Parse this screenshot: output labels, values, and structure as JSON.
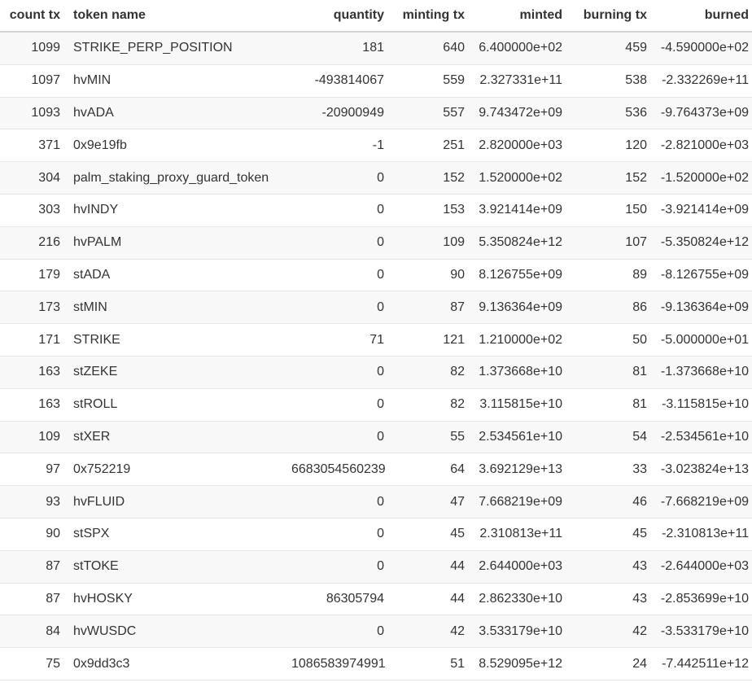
{
  "table": {
    "headers": [
      "count tx",
      "token name",
      "quantity",
      "minting tx",
      "minted",
      "burning tx",
      "burned"
    ],
    "rows": [
      [
        "1099",
        "STRIKE_PERP_POSITION",
        "181",
        "640",
        "6.400000e+02",
        "459",
        "-4.590000e+02"
      ],
      [
        "1097",
        "hvMIN",
        "-493814067",
        "559",
        "2.327331e+11",
        "538",
        "-2.332269e+11"
      ],
      [
        "1093",
        "hvADA",
        "-20900949",
        "557",
        "9.743472e+09",
        "536",
        "-9.764373e+09"
      ],
      [
        "371",
        "0x9e19fb",
        "-1",
        "251",
        "2.820000e+03",
        "120",
        "-2.821000e+03"
      ],
      [
        "304",
        "palm_staking_proxy_guard_token",
        "0",
        "152",
        "1.520000e+02",
        "152",
        "-1.520000e+02"
      ],
      [
        "303",
        "hvINDY",
        "0",
        "153",
        "3.921414e+09",
        "150",
        "-3.921414e+09"
      ],
      [
        "216",
        "hvPALM",
        "0",
        "109",
        "5.350824e+12",
        "107",
        "-5.350824e+12"
      ],
      [
        "179",
        "stADA",
        "0",
        "90",
        "8.126755e+09",
        "89",
        "-8.126755e+09"
      ],
      [
        "173",
        "stMIN",
        "0",
        "87",
        "9.136364e+09",
        "86",
        "-9.136364e+09"
      ],
      [
        "171",
        "STRIKE",
        "71",
        "121",
        "1.210000e+02",
        "50",
        "-5.000000e+01"
      ],
      [
        "163",
        "stZEKE",
        "0",
        "82",
        "1.373668e+10",
        "81",
        "-1.373668e+10"
      ],
      [
        "163",
        "stROLL",
        "0",
        "82",
        "3.115815e+10",
        "81",
        "-3.115815e+10"
      ],
      [
        "109",
        "stXER",
        "0",
        "55",
        "2.534561e+10",
        "54",
        "-2.534561e+10"
      ],
      [
        "97",
        "0x752219",
        "6683054560239",
        "64",
        "3.692129e+13",
        "33",
        "-3.023824e+13"
      ],
      [
        "93",
        "hvFLUID",
        "0",
        "47",
        "7.668219e+09",
        "46",
        "-7.668219e+09"
      ],
      [
        "90",
        "stSPX",
        "0",
        "45",
        "2.310813e+11",
        "45",
        "-2.310813e+11"
      ],
      [
        "87",
        "stTOKE",
        "0",
        "44",
        "2.644000e+03",
        "43",
        "-2.644000e+03"
      ],
      [
        "87",
        "hvHOSKY",
        "86305794",
        "44",
        "2.862330e+10",
        "43",
        "-2.853699e+10"
      ],
      [
        "84",
        "hvWUSDC",
        "0",
        "42",
        "3.533179e+10",
        "42",
        "-3.533179e+10"
      ],
      [
        "75",
        "0x9dd3c3",
        "1086583974991",
        "51",
        "8.529095e+12",
        "24",
        "-7.442511e+12"
      ]
    ]
  }
}
